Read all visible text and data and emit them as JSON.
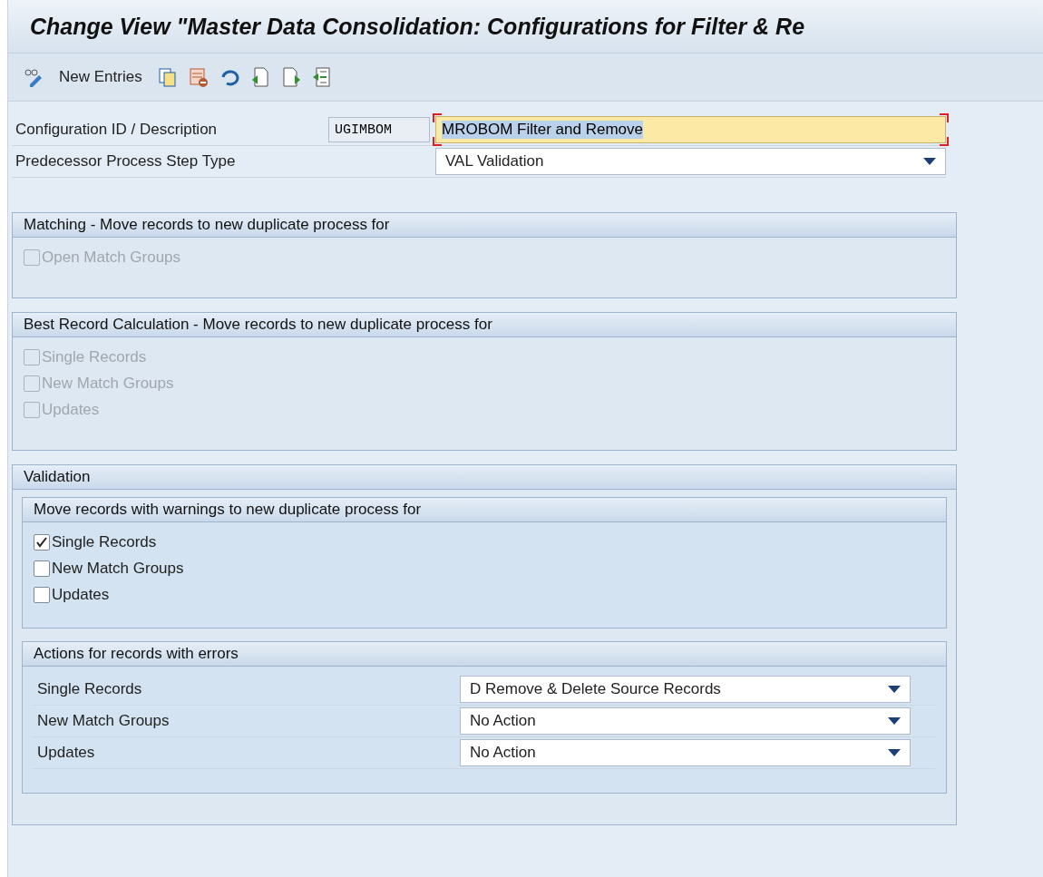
{
  "window": {
    "title": "Change View \"Master Data Consolidation: Configurations for Filter & Re"
  },
  "toolbar": {
    "new_entries": "New Entries"
  },
  "header_fields": {
    "config": {
      "label": "Configuration ID / Description",
      "id": "UGIMBOM",
      "description": "MROBOM Filter and Remove",
      "focused": true
    },
    "predecessor": {
      "label": "Predecessor Process Step Type",
      "value": "VAL Validation"
    }
  },
  "groups": [
    {
      "title": "Matching - Move records to new duplicate process for",
      "checkboxes": [
        {
          "label": "Open Match Groups",
          "checked": false,
          "disabled": true
        }
      ]
    },
    {
      "title": "Best Record Calculation - Move records to new duplicate process for",
      "checkboxes": [
        {
          "label": "Single Records",
          "checked": false,
          "disabled": true
        },
        {
          "label": "New Match Groups",
          "checked": false,
          "disabled": true
        },
        {
          "label": "Updates",
          "checked": false,
          "disabled": true
        }
      ]
    },
    {
      "title": "Validation",
      "subgroups": [
        {
          "kind": "checkboxes",
          "title": "Move records with warnings to new duplicate process for",
          "items": [
            {
              "label": "Single Records",
              "checked": true,
              "disabled": false
            },
            {
              "label": "New Match Groups",
              "checked": false,
              "disabled": false
            },
            {
              "label": "Updates",
              "checked": false,
              "disabled": false
            }
          ]
        },
        {
          "kind": "dropdowns",
          "title": "Actions for records with errors",
          "items": [
            {
              "label": "Single Records",
              "value": "D Remove & Delete Source Records"
            },
            {
              "label": "New Match Groups",
              "value": "No Action"
            },
            {
              "label": "Updates",
              "value": "No Action"
            }
          ]
        }
      ]
    }
  ]
}
